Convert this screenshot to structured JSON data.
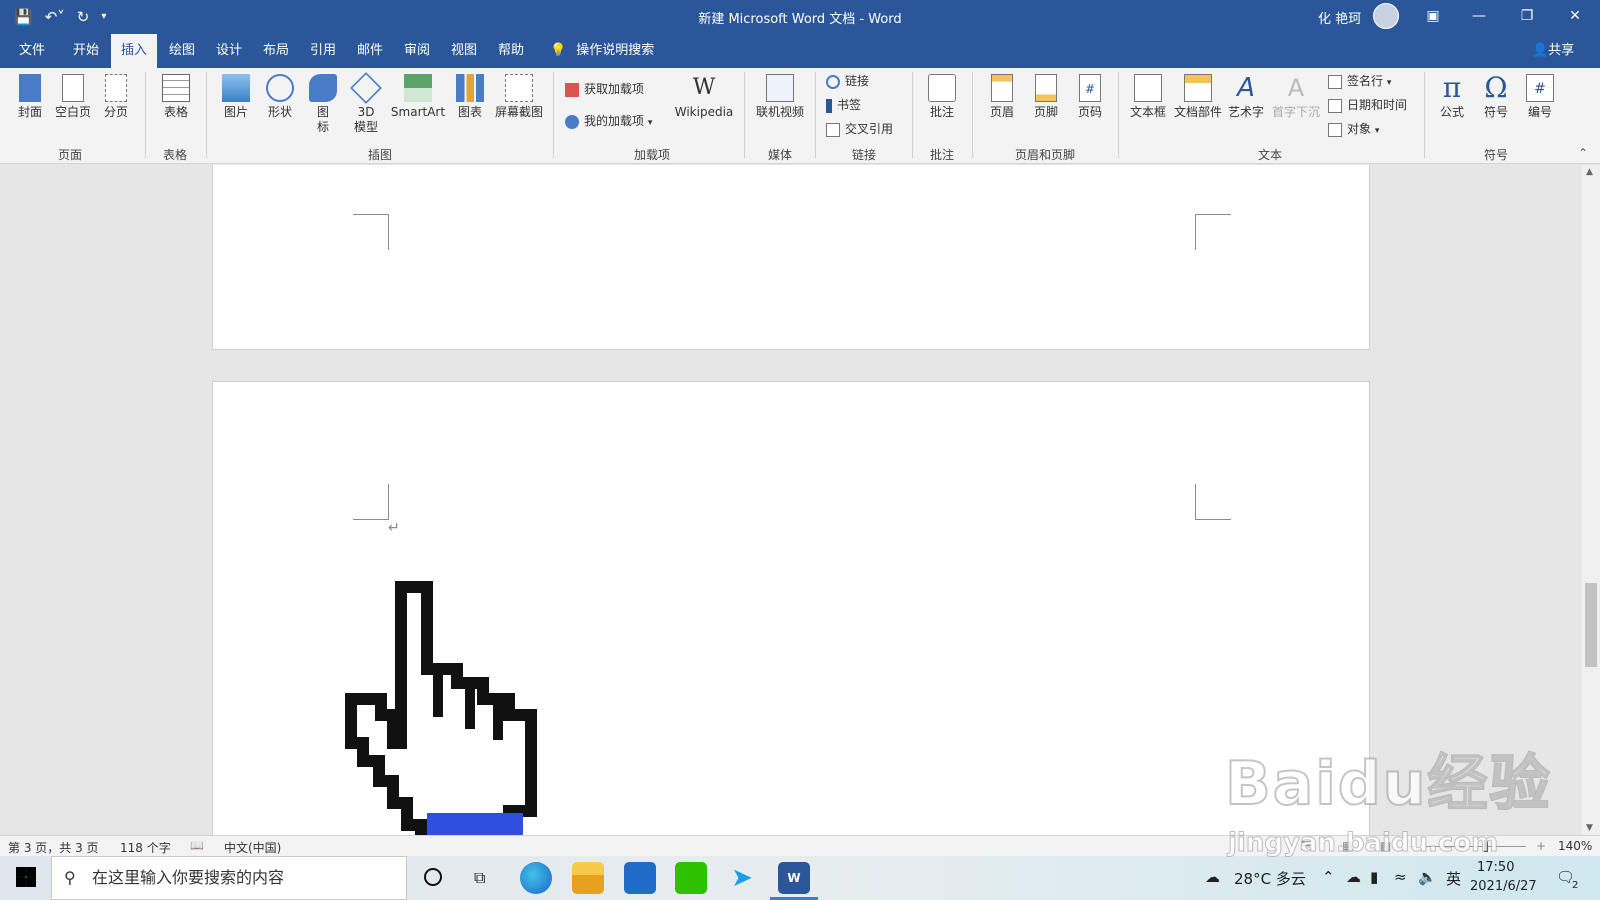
{
  "window": {
    "title": "新建 Microsoft Word 文档  -  Word",
    "user_name": "化 艳珂",
    "share_label": "共享",
    "tell_me": "操作说明搜索"
  },
  "tabs": [
    "文件",
    "开始",
    "插入",
    "绘图",
    "设计",
    "布局",
    "引用",
    "邮件",
    "审阅",
    "视图",
    "帮助"
  ],
  "active_tab": "插入",
  "ribbon": {
    "pages": {
      "cover": "封面",
      "blank": "空白页",
      "break": "分页",
      "label": "页面"
    },
    "tables": {
      "table": "表格",
      "label": "表格"
    },
    "illustrations": {
      "picture": "图片",
      "shapes": "形状",
      "icons": "图\n标",
      "model3d": "3D\n模型",
      "smartart": "SmartArt",
      "chart": "图表",
      "screenshot": "屏幕截图",
      "label": "插图"
    },
    "addins": {
      "get": "获取加载项",
      "mine": "我的加载项",
      "wikipedia": "Wikipedia",
      "wiki_icon": "W",
      "label": "加载项"
    },
    "media": {
      "video": "联机视频",
      "label": "媒体"
    },
    "links": {
      "link": "链接",
      "bookmark": "书签",
      "crossref": "交叉引用",
      "label": "链接"
    },
    "comments": {
      "comment": "批注",
      "label": "批注"
    },
    "headerfooter": {
      "header": "页眉",
      "footer": "页脚",
      "pagenum": "页码",
      "label": "页眉和页脚"
    },
    "text": {
      "textbox": "文本框",
      "parts": "文档部件",
      "wordart": "艺术字",
      "dropcap": "首字下沉",
      "signature": "签名行",
      "datetime": "日期和时间",
      "object": "对象",
      "label": "文本"
    },
    "symbols": {
      "equation": "公式",
      "symbol": "符号",
      "number": "编号",
      "pi": "π",
      "omega": "Ω",
      "label": "符号"
    }
  },
  "status": {
    "page": "第 3 页，共 3 页",
    "words": "118 个字",
    "language": "中文(中国)",
    "zoom": "140%"
  },
  "taskbar": {
    "search_placeholder": "在这里输入你要搜索的内容",
    "weather": "28°C  多云",
    "ime": "英",
    "time": "17:50",
    "date": "2021/6/27",
    "notification_count": "2"
  },
  "watermark": {
    "brand": "Baidu经验",
    "url": "jingyan.baidu.com"
  },
  "colors": {
    "accent": "#2b579a",
    "ribbon_bg": "#f3f3f3",
    "canvas_bg": "#e6e6e6",
    "cursor_fill": "#2f4fe0"
  }
}
